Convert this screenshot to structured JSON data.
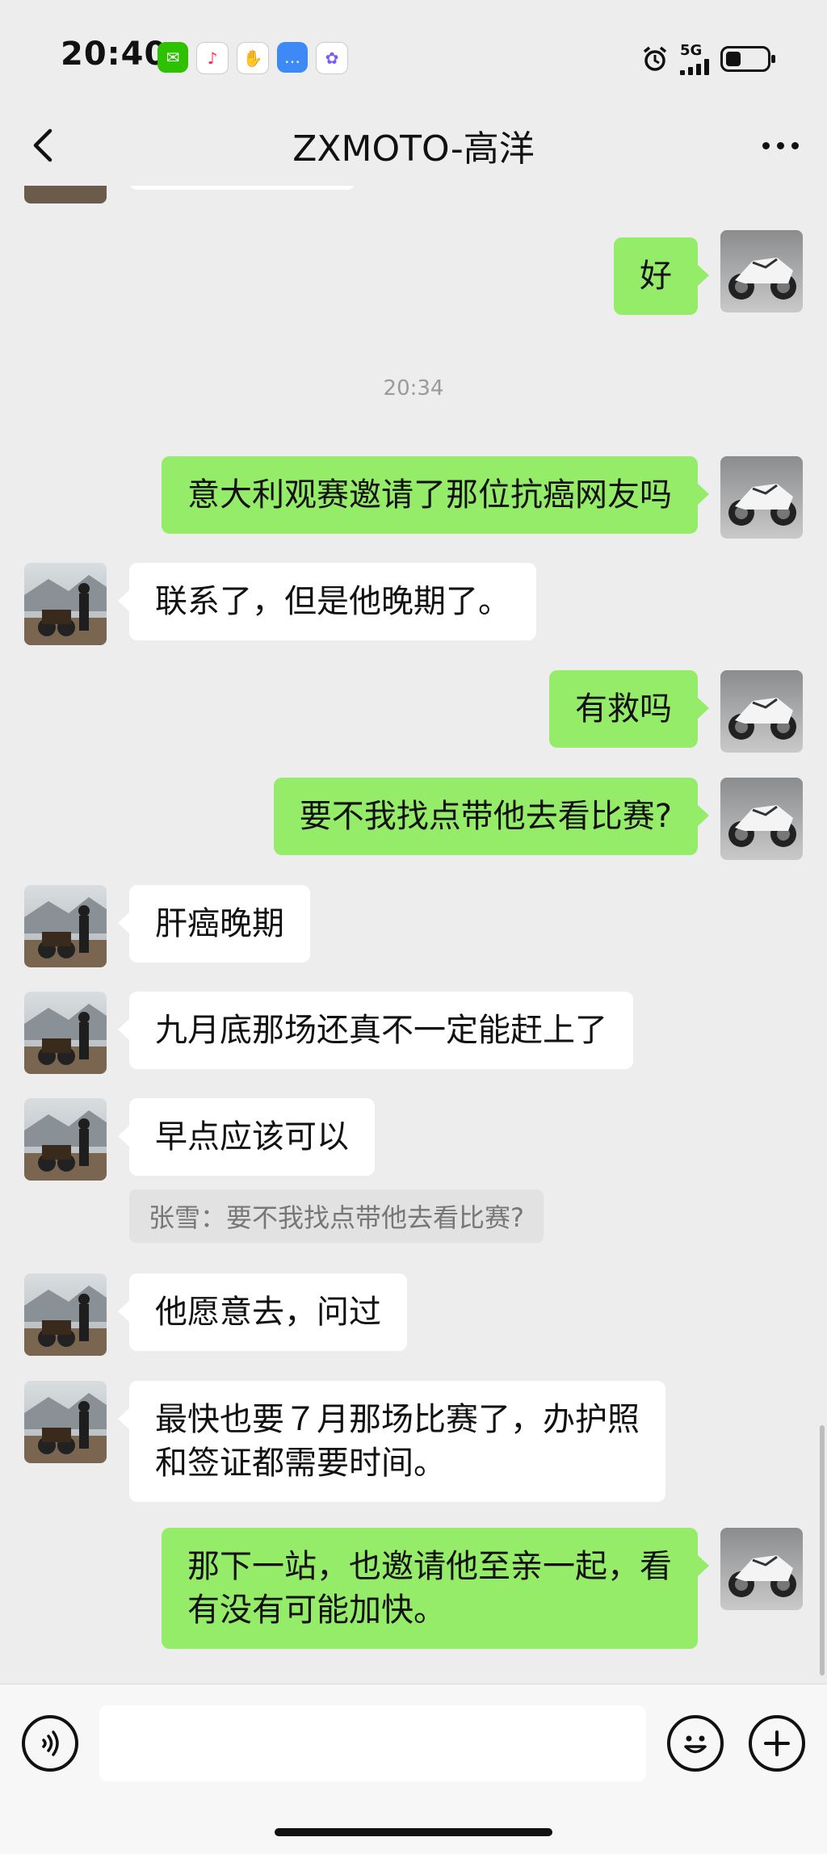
{
  "status_bar": {
    "time": "20:40",
    "network": "5G",
    "app_icons": [
      "wechat-icon",
      "music-icon",
      "hand-icon",
      "message-icon",
      "photos-icon"
    ],
    "status_icons": [
      "alarm-icon",
      "signal-icon",
      "battery-icon"
    ]
  },
  "header": {
    "title": "ZXMOTO-高洋",
    "back_icon": "chevron-left-icon",
    "more_icon": "more-dots-icon"
  },
  "messages": [
    {
      "type": "text",
      "side": "out",
      "text": "好"
    },
    {
      "type": "timestamp",
      "text": "20:34"
    },
    {
      "type": "text",
      "side": "out",
      "text": "意大利观赛邀请了那位抗癌网友吗"
    },
    {
      "type": "text",
      "side": "in",
      "text": "联系了，但是他晚期了。"
    },
    {
      "type": "text",
      "side": "out",
      "text": "有救吗"
    },
    {
      "type": "text",
      "side": "out",
      "text": "要不我找点带他去看比赛?"
    },
    {
      "type": "text",
      "side": "in",
      "text": "肝癌晚期"
    },
    {
      "type": "text",
      "side": "in",
      "text": "九月底那场还真不一定能赶上了"
    },
    {
      "type": "text",
      "side": "in",
      "text": "早点应该可以"
    },
    {
      "type": "quote",
      "text": "张雪：要不我找点带他去看比赛?"
    },
    {
      "type": "text",
      "side": "in",
      "text": "他愿意去，问过"
    },
    {
      "type": "text",
      "side": "in",
      "line1": "最快也要７月那场比赛了，办护照",
      "line2": "和签证都需要时间。"
    },
    {
      "type": "text",
      "side": "out",
      "line1": "那下一站，也邀请他至亲一起，看",
      "line2": "有没有可能加快。"
    }
  ],
  "input_bar": {
    "voice_icon": "voice-mode-icon",
    "mic_icon": "microphone-icon",
    "emoji_icon": "emoji-icon",
    "plus_icon": "plus-icon",
    "text_value": ""
  },
  "colors": {
    "background": "#ededed",
    "outgoing_bubble": "#95ec69",
    "incoming_bubble": "#ffffff"
  }
}
